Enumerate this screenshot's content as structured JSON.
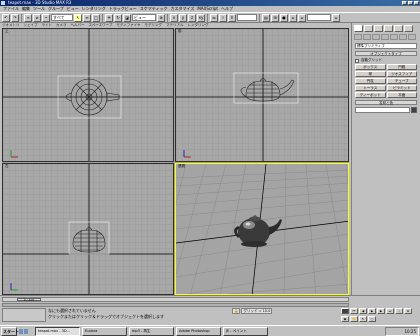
{
  "window": {
    "title": "teapot.max - 3D Studio MAX R3"
  },
  "menu": [
    "ファイル",
    "編集",
    "ツール",
    "グループ",
    "ビュー",
    "レンダリング",
    "トラックビュー",
    "スケマティック",
    "カスタマイズ",
    "MAXScript",
    "ヘルプ"
  ],
  "toolbar": {
    "view_dropdown": "ビュー",
    "filter_dropdown": "すべて"
  },
  "tabs": [
    "ジオメトリ",
    "シェイプ",
    "ライト",
    "カメラ",
    "ヘルパー",
    "スペースワープ",
    "モディファイヤ",
    "モデリング",
    "マテリアル",
    "レンダリング"
  ],
  "viewports": {
    "top": "上",
    "front": "前",
    "left": "左",
    "perspective": "透視"
  },
  "command_panel": {
    "category_dropdown": "標準プリミティブ",
    "rollout_object_type": "オブジェクトタイプ",
    "autogrid": "自動グリッド",
    "objects": [
      "ボックス",
      "円錐",
      "球",
      "ジオスフィア",
      "円柱",
      "チューブ",
      "トーラス",
      "ピラミッド",
      "ティーポット",
      "平面"
    ],
    "rollout_name_color": "名前と色"
  },
  "time": {
    "frame": "0 / 100"
  },
  "prompt": {
    "line1": "なにも選択されていません",
    "line2": "クリックまたはクリック＆ドラッグでオブジェクトを選択します"
  },
  "status": {
    "grid": "グリッド = 10.0"
  },
  "taskbar": {
    "start": "スタート",
    "items": [
      "teapot.max - 3D...",
      "Eudora",
      "mp3 - 再生",
      "Adobe Photoshop",
      "JE - ペイント"
    ],
    "clock": "10:25"
  }
}
